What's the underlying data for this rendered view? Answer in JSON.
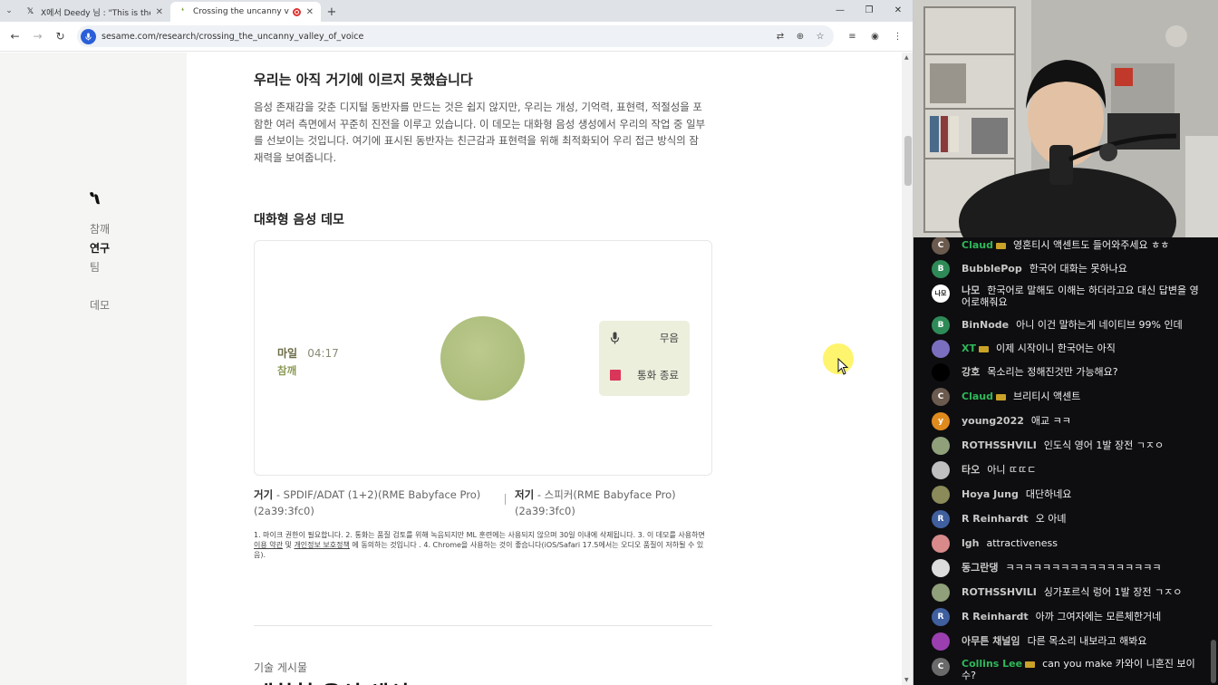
{
  "browser": {
    "tabs": [
      {
        "title": "X에서 Deedy 님 : \"This is the",
        "active": false
      },
      {
        "title": "Crossing the uncanny valle",
        "active": true
      }
    ],
    "url": "sesame.com/research/crossing_the_uncanny_valley_of_voice"
  },
  "sidebar": {
    "links": [
      "참깨",
      "연구",
      "팀",
      "데모"
    ],
    "current": "연구"
  },
  "article": {
    "heading": "우리는 아직 거기에 이르지 못했습니다",
    "paragraph": "음성 존재감을 갖춘 디지털 동반자를 만드는 것은 쉽지 않지만, 우리는 개성, 기억력, 표현력, 적절성을 포함한 여러 측면에서 꾸준히 진전을 이루고 있습니다. 이 데모는 대화형 음성 생성에서 우리의 작업 중 일부를 선보이는 것입니다. 여기에 표시된 동반자는 친근감과 표현력을 위해 최적화되어 우리 접근 방식의 잠재력을 보여줍니다.",
    "demo_heading": "대화형 음성 데모",
    "demo": {
      "caller_name": "마일",
      "call_time": "04:17",
      "status": "참깨",
      "mute_label": "무음",
      "end_label": "통화 종료"
    },
    "devices": {
      "input_label": "거기",
      "input_device": "SPDIF/ADAT (1+2)(RME Babyface Pro) (2a39:3fc0)",
      "output_label": "저기",
      "output_device": "스피커(RME Babyface Pro) (2a39:3fc0)"
    },
    "notes": {
      "part1": "1. 마이크 권한이 필요합니다. 2. 통화는 품질 검토를 위해 녹음되지만 ML 훈련에는 사용되지 않으며 30일 이내에 삭제됩니다. 3. 이 데모를 사용하면 ",
      "terms_link": "이용 약관",
      "and": " 및 ",
      "privacy_link": "개인정보 보호정책",
      "part2": " 에 동의하는 것입니다 . 4. Chrome을 사용하는 것이 좋습니다(iOS/Safari 17.5에서는 오디오 품질이 저하될 수 있음)."
    },
    "post_label": "기술 게시물",
    "post_title": "대화형 음성 생성"
  },
  "chat": {
    "messages": [
      {
        "user": "Claud",
        "text": "영혼티시 액센트도 들어와주세요 ㅎㅎ",
        "avatar": "C",
        "avatar_color": "#6b5a4e",
        "user_color": "#2fb85a",
        "badge": true
      },
      {
        "user": "BubblePop",
        "text": "한국어 대화는 못하나요",
        "avatar": "B",
        "avatar_color": "#2e8b57",
        "user_color": "#c8c8c8",
        "badge": false
      },
      {
        "user": "나모",
        "text": "한국어로 말해도 이해는 하더라고요 대신 답변을 영어로해줘요",
        "avatar": "나모",
        "avatar_color": "#ffffff",
        "user_color": "#c8c8c8",
        "badge": false
      },
      {
        "user": "BinNode",
        "text": "아니 이건 말하는게 네이티브 99% 인데",
        "avatar": "B",
        "avatar_color": "#2e8b57",
        "user_color": "#c8c8c8",
        "badge": false
      },
      {
        "user": "XT",
        "text": "이제 시작이니 한국어는 아직",
        "avatar": "",
        "avatar_color": "#7a6fbf",
        "user_color": "#2fb85a",
        "badge": true
      },
      {
        "user": "강호",
        "text": "목소리는 정해진것만 가능해요?",
        "avatar": "",
        "avatar_color": "#000000",
        "user_color": "#c8c8c8",
        "badge": false
      },
      {
        "user": "Claud",
        "text": "브리티시 액센트",
        "avatar": "C",
        "avatar_color": "#6b5a4e",
        "user_color": "#2fb85a",
        "badge": true
      },
      {
        "user": "young2022",
        "text": "애교 ㅋㅋ",
        "avatar": "y",
        "avatar_color": "#e08a1e",
        "user_color": "#c8c8c8",
        "badge": false
      },
      {
        "user": "ROTHSSHVILI",
        "text": "인도식 영어 1발 장전 ㄱㅈㅇ",
        "avatar": "",
        "avatar_color": "#8fa07a",
        "user_color": "#c8c8c8",
        "badge": false
      },
      {
        "user": "타오",
        "text": "아니 ㄸㄸㄷ",
        "avatar": "",
        "avatar_color": "#bfbfbf",
        "user_color": "#c8c8c8",
        "badge": false
      },
      {
        "user": "Hoya Jung",
        "text": "대단하네요",
        "avatar": "",
        "avatar_color": "#8a8a5a",
        "user_color": "#c8c8c8",
        "badge": false
      },
      {
        "user": "R Reinhardt",
        "text": "오 아녜",
        "avatar": "R",
        "avatar_color": "#3f5f9f",
        "user_color": "#c8c8c8",
        "badge": false
      },
      {
        "user": "lgh",
        "text": "attractiveness",
        "avatar": "",
        "avatar_color": "#d88a8a",
        "user_color": "#c8c8c8",
        "badge": false
      },
      {
        "user": "동그란댕",
        "text": "ㅋㅋㅋㅋㅋㅋㅋㅋㅋㅋㅋㅋㅋㅋㅋㅋㅋ",
        "avatar": "",
        "avatar_color": "#dcdcdc",
        "user_color": "#c8c8c8",
        "badge": false
      },
      {
        "user": "ROTHSSHVILI",
        "text": "싱가포르식 렁어 1발 장전 ㄱㅈㅇ",
        "avatar": "",
        "avatar_color": "#8fa07a",
        "user_color": "#c8c8c8",
        "badge": false
      },
      {
        "user": "R Reinhardt",
        "text": "아까 그여자에는 모른체한거네",
        "avatar": "R",
        "avatar_color": "#3f5f9f",
        "user_color": "#c8c8c8",
        "badge": false
      },
      {
        "user": "아무튼 채널임",
        "text": "다른 목소리 내보라고 해봐요",
        "avatar": "",
        "avatar_color": "#9b3fb0",
        "user_color": "#c8c8c8",
        "badge": false
      },
      {
        "user": "Collins Lee",
        "text": "can you make 카와이 니혼진 보이수?",
        "avatar": "C",
        "avatar_color": "#6a6a6a",
        "user_color": "#2fb85a",
        "badge": true
      }
    ]
  }
}
